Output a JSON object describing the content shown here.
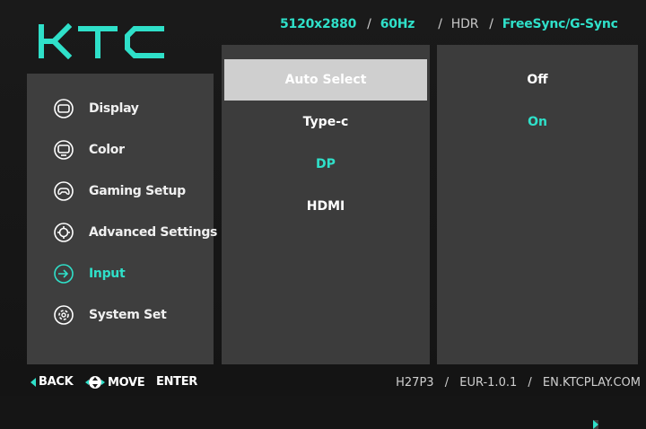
{
  "brand": {
    "logo_text": "KTC"
  },
  "status_bar": {
    "resolution": "5120x2880",
    "refresh_rate": "60Hz",
    "hdr": "HDR",
    "sync": "FreeSync/G-Sync"
  },
  "nav": {
    "items": [
      {
        "label": "Display",
        "icon": "display-icon"
      },
      {
        "label": "Color",
        "icon": "color-icon"
      },
      {
        "label": "Gaming Setup",
        "icon": "gamepad-icon"
      },
      {
        "label": "Advanced Settings",
        "icon": "gear-icon"
      },
      {
        "label": "Input",
        "icon": "input-icon",
        "active": true
      },
      {
        "label": "System Set",
        "icon": "system-icon"
      }
    ]
  },
  "input_options": [
    {
      "label": "Auto Select",
      "selected": true
    },
    {
      "label": "Type-c"
    },
    {
      "label": "DP",
      "active": true
    },
    {
      "label": "HDMI"
    }
  ],
  "values": [
    {
      "label": "Off"
    },
    {
      "label": "On",
      "active": true
    }
  ],
  "controls": {
    "back": "BACK",
    "move": "MOVE",
    "enter": "ENTER"
  },
  "footer": {
    "model": "H27P3",
    "firmware": "EUR-1.0.1",
    "website": "EN.KTCPLAY.COM"
  },
  "colors": {
    "accent": "#2fe0c9",
    "panel": "#3c3c3c",
    "selected_row": "#cfcfcf",
    "background": "#151515"
  }
}
